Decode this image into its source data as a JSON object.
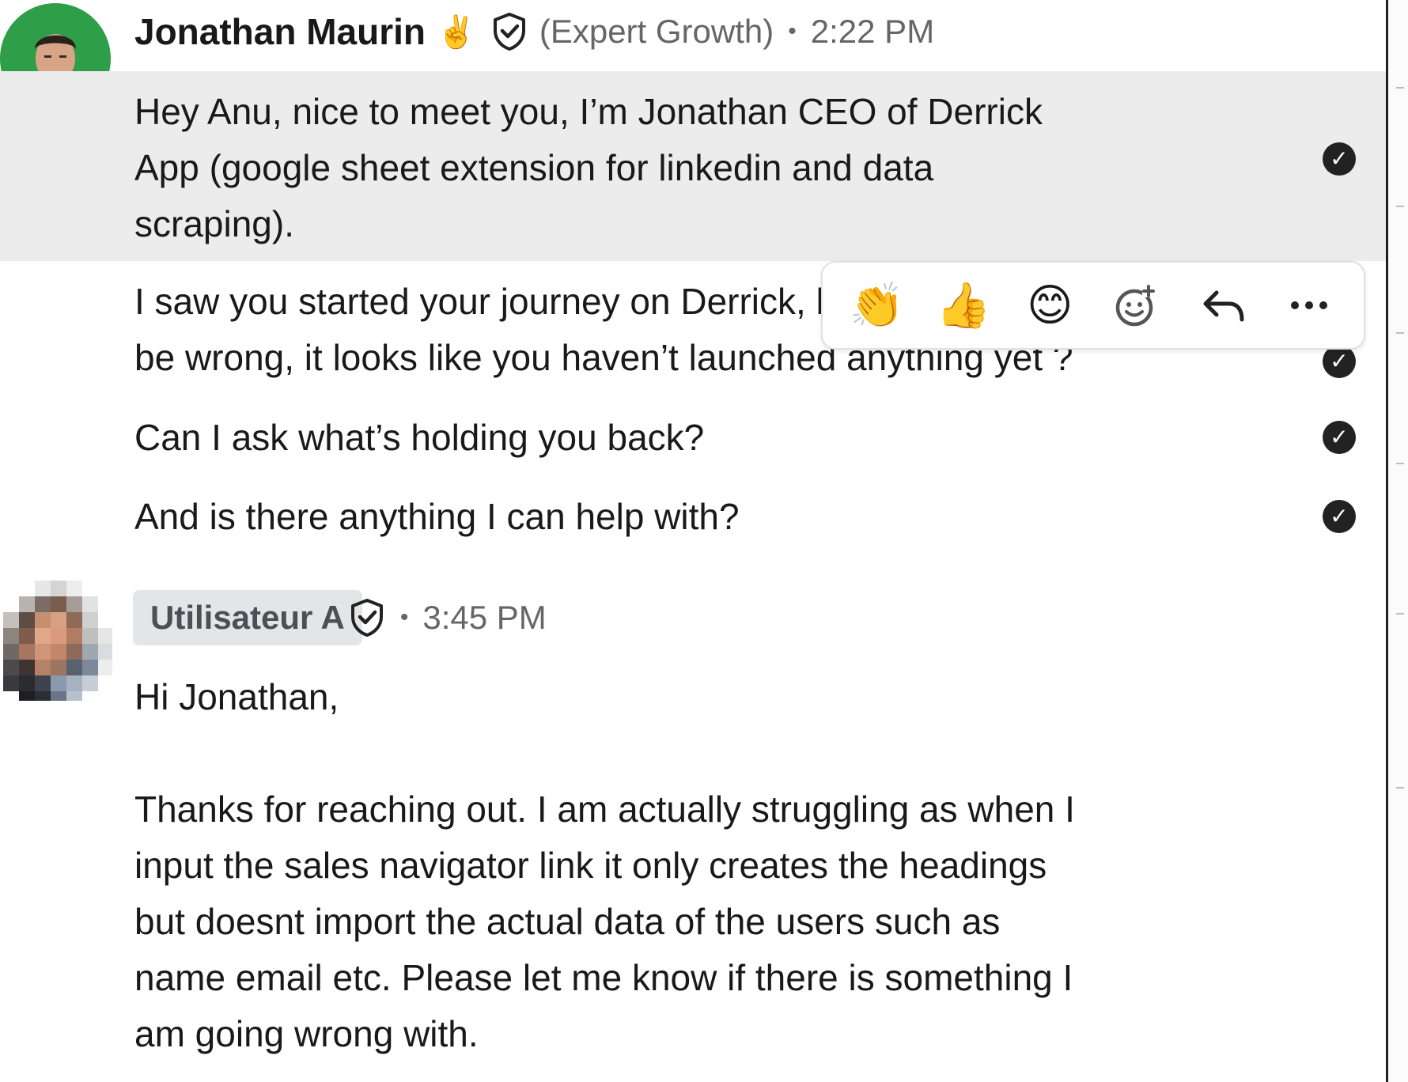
{
  "messages": [
    {
      "sender": "Jonathan Maurin",
      "sender_emoji": "✌️",
      "role": "(Expert Growth)",
      "time": "2:22 PM",
      "lines": [
        "Hey Anu, nice to meet you, I’m Jonathan CEO of Derrick\nApp (google sheet extension for linkedin and data\nscraping).",
        "I saw you started your journey on Derrick, but I might\nbe wrong, it looks like you haven’t launched anything yet ?",
        "Can I ask what’s holding you back?",
        "And is there anything I can help with?"
      ]
    },
    {
      "sender": "Utilisateur A",
      "time": "3:45 PM",
      "text": "Hi Jonathan,\n\nThanks for reaching out. I am actually struggling as when I\ninput the sales navigator link it only creates the headings\nbut doesnt import the actual data of the users such as\nname email etc. Please let me know if there is something I\nam going wrong with."
    }
  ],
  "separator": "•",
  "read_check_glyph": "✓",
  "reactions": {
    "clap": "👏",
    "thumbs_up": "👍",
    "smile": "😊",
    "reply": "↩",
    "more": "···"
  },
  "icons": [
    "verified-shield-icon",
    "add-reaction-icon",
    "reply-icon",
    "more-options-icon",
    "read-receipt-icon"
  ],
  "colors": {
    "highlight_bg": "#ececec",
    "avatar_bg": "#2e9e48",
    "name_chip_bg": "#e3e5e7",
    "muted_text": "#666666"
  }
}
